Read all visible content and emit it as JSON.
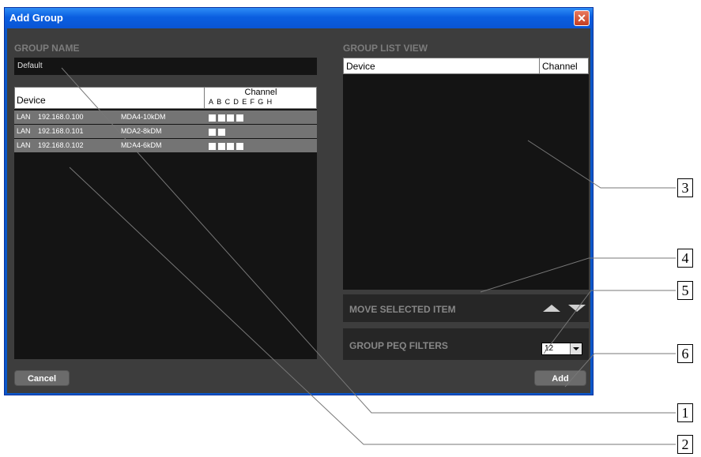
{
  "window": {
    "title": "Add Group",
    "close_glyph": "✕"
  },
  "group_name": {
    "label": "GROUP NAME",
    "value": "Default"
  },
  "device_table": {
    "header_device": "Device",
    "header_channel": "Channel",
    "channel_letters": "ABCDEFGH",
    "rows": [
      {
        "interface": "LAN",
        "ip": "192.168.0.100",
        "model": "MDA4-10kDM",
        "channels": 4
      },
      {
        "interface": "LAN",
        "ip": "192.168.0.101",
        "model": "MDA2-8kDM",
        "channels": 2
      },
      {
        "interface": "LAN",
        "ip": "192.168.0.102",
        "model": "MDA4-6kDM",
        "channels": 4
      }
    ]
  },
  "group_list": {
    "label": "GROUP LIST VIEW",
    "header_device": "Device",
    "header_channel": "Channel"
  },
  "move_item": {
    "label": "MOVE SELECTED ITEM",
    "up_icon": "triangle-up-icon",
    "down_icon": "triangle-down-icon"
  },
  "peq": {
    "label": "GROUP PEQ FILTERS",
    "value": "12"
  },
  "buttons": {
    "cancel": "Cancel",
    "add": "Add"
  },
  "callouts": [
    "1",
    "2",
    "3",
    "4",
    "5",
    "6"
  ],
  "colors": {
    "titlebar": "#0a57c8",
    "client": "#3d3d3d",
    "panel": "#141414",
    "row": "#747474"
  }
}
